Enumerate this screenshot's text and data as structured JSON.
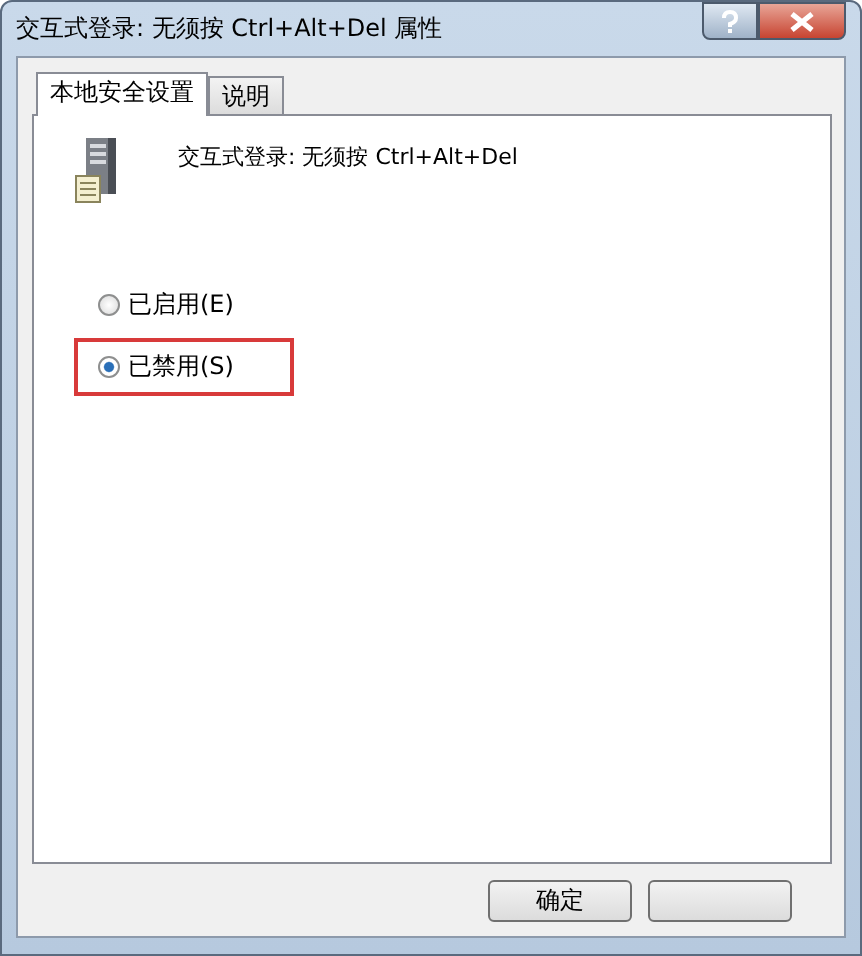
{
  "window": {
    "title": "交互式登录: 无须按 Ctrl+Alt+Del 属性"
  },
  "tabs": [
    {
      "label": "本地安全设置",
      "selected": true
    },
    {
      "label": "说明",
      "selected": false
    }
  ],
  "policy": {
    "name": "交互式登录: 无须按 Ctrl+Alt+Del"
  },
  "options": [
    {
      "label": "已启用(E)",
      "selected": false,
      "highlighted": false
    },
    {
      "label": "已禁用(S)",
      "selected": true,
      "highlighted": true
    }
  ],
  "buttons": [
    {
      "label": "确定"
    }
  ]
}
